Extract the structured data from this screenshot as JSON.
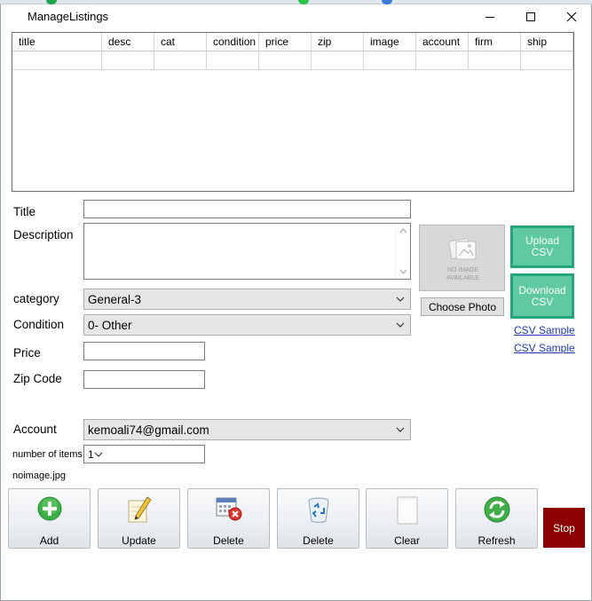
{
  "window": {
    "title": "ManageListings",
    "controls": [
      "minimize-icon",
      "maximize-icon",
      "close-icon"
    ]
  },
  "grid": {
    "columns": [
      "title",
      "desc",
      "cat",
      "condition",
      "price",
      "zip",
      "image",
      "account",
      "firm",
      "ship"
    ],
    "rows": [
      [
        "",
        "",
        "",
        "",
        "",
        "",
        "",
        "",
        "",
        ""
      ]
    ]
  },
  "form": {
    "title_label": "Title",
    "title_value": "",
    "description_label": "Description",
    "description_value": "",
    "category_label": "category",
    "category_value": "General-3",
    "condition_label": "Condition",
    "condition_value": "0- Other",
    "price_label": "Price",
    "price_value": "",
    "zip_label": "Zip Code",
    "zip_value": "",
    "account_label": "Account",
    "account_value": "kemoali74@gmail.com",
    "items_label": "number of items",
    "items_value": "1",
    "image_filename": "noimage.jpg"
  },
  "photo": {
    "placeholder_line1": "NO IMAGE",
    "placeholder_line2": "AVAILABLE",
    "choose_label": "Choose Photo"
  },
  "side_buttons": {
    "upload_line1": "Upload",
    "upload_line2": "CSV",
    "download_line1": "Download",
    "download_line2": "CSV",
    "sample_link1": "CSV Sample",
    "sample_link2": "CSV Sample"
  },
  "toolbar": {
    "add": "Add",
    "update": "Update",
    "delete1": "Delete",
    "delete2": "Delete",
    "clear": "Clear",
    "refresh": "Refresh",
    "stop": "Stop"
  },
  "colors": {
    "accent_green": "#5fc9a1",
    "accent_green_border": "#23a57d",
    "stop_red": "#8b0000",
    "link_blue": "#1a3ab0"
  }
}
